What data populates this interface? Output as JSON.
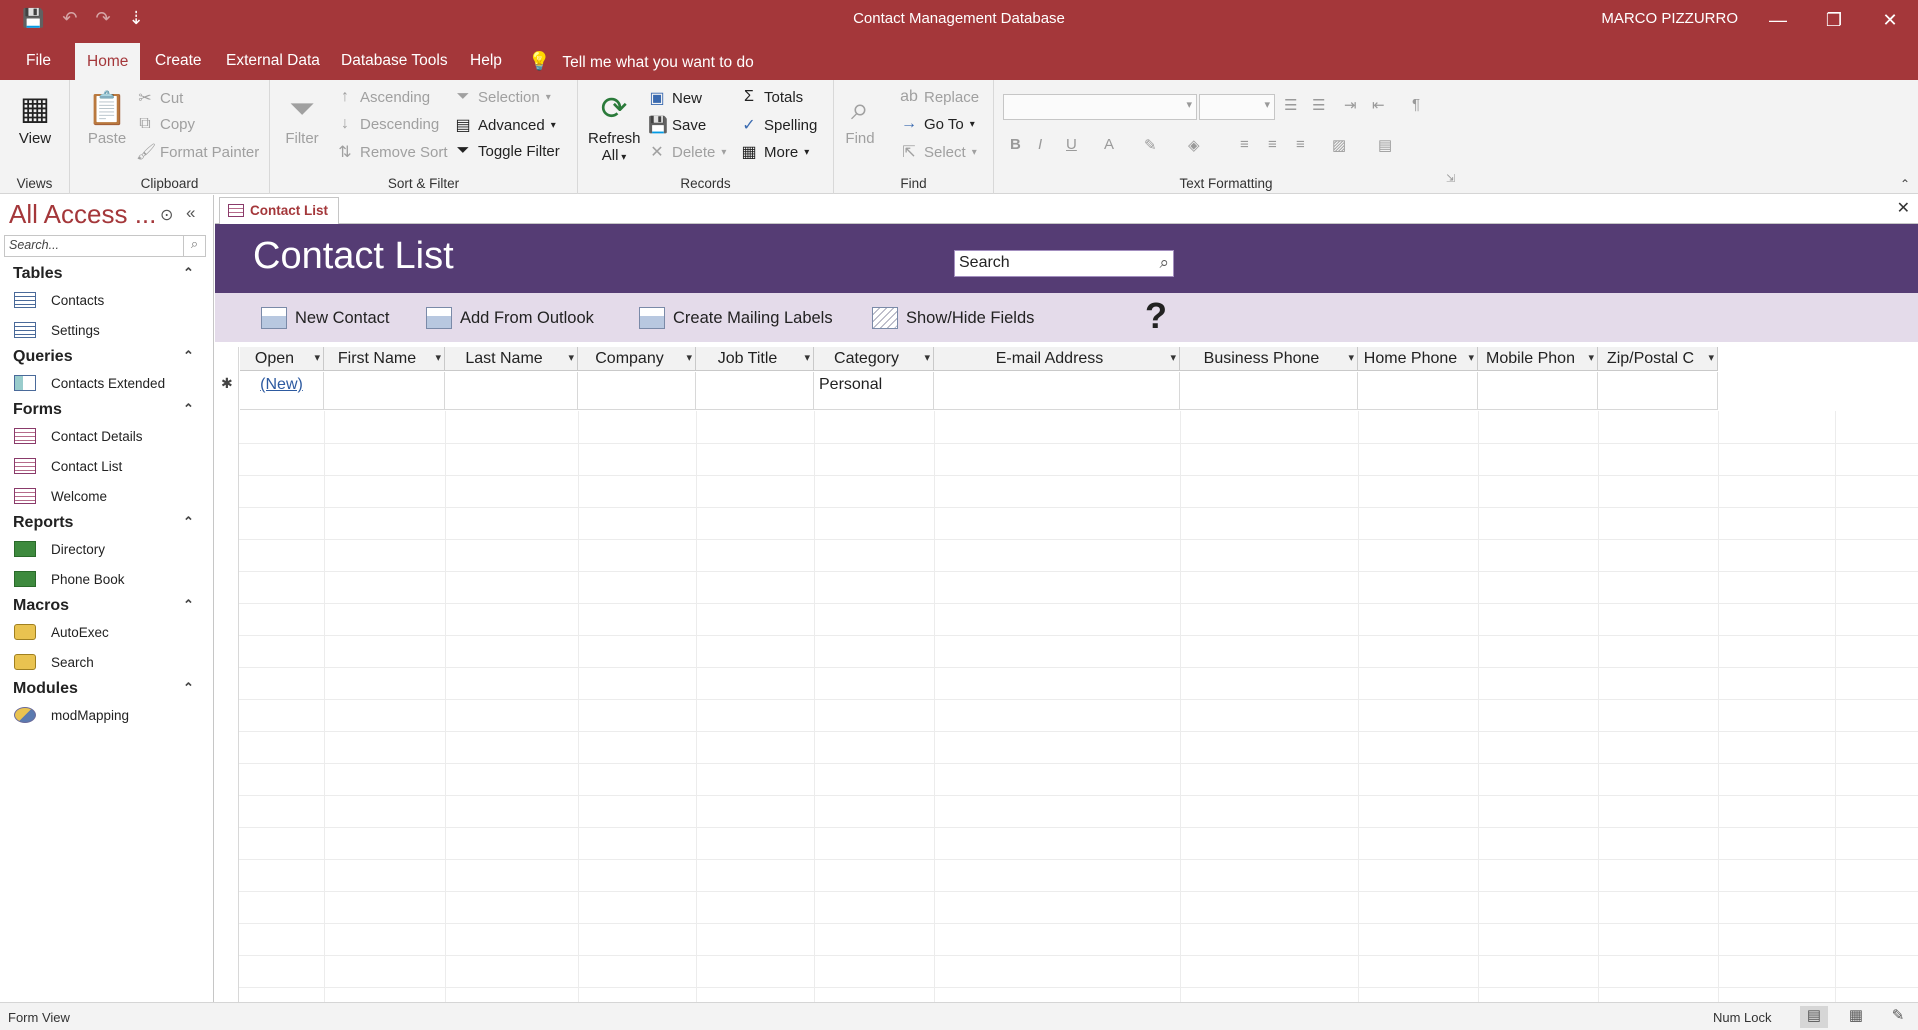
{
  "window": {
    "title": "Contact Management Database",
    "user": "MARCO PIZZURRO",
    "minimize": "—",
    "restore": "❐",
    "close": "✕"
  },
  "qat": {
    "save": "💾",
    "undo": "↶",
    "redo": "↷",
    "customize": "⇣"
  },
  "tabs": {
    "file": "File",
    "home": "Home",
    "create": "Create",
    "external_data": "External Data",
    "database_tools": "Database Tools",
    "help": "Help",
    "tell_me": "Tell me what you want to do"
  },
  "ribbon": {
    "views": {
      "label": "Views",
      "view": "View"
    },
    "clipboard": {
      "label": "Clipboard",
      "paste": "Paste",
      "cut": "Cut",
      "copy": "Copy",
      "format_painter": "Format Painter"
    },
    "sort_filter": {
      "label": "Sort & Filter",
      "filter": "Filter",
      "ascending": "Ascending",
      "descending": "Descending",
      "remove_sort": "Remove Sort",
      "selection": "Selection",
      "advanced": "Advanced",
      "toggle_filter": "Toggle Filter"
    },
    "records": {
      "label": "Records",
      "refresh": "Refresh",
      "all": "All",
      "new": "New",
      "save": "Save",
      "delete": "Delete",
      "totals": "Totals",
      "spelling": "Spelling",
      "more": "More"
    },
    "find": {
      "label": "Find",
      "find": "Find",
      "replace": "Replace",
      "go_to": "Go To",
      "select": "Select"
    },
    "text_formatting": {
      "label": "Text Formatting",
      "bold": "B",
      "italic": "I",
      "underline": "U",
      "font_color": "A"
    }
  },
  "nav": {
    "title": "All Access ...",
    "search_placeholder": "Search...",
    "categories": {
      "tables": "Tables",
      "queries": "Queries",
      "forms": "Forms",
      "reports": "Reports",
      "macros": "Macros",
      "modules": "Modules"
    },
    "items": {
      "contacts": "Contacts",
      "settings": "Settings",
      "contacts_extended": "Contacts Extended",
      "contact_details": "Contact Details",
      "contact_list": "Contact List",
      "welcome": "Welcome",
      "directory": "Directory",
      "phone_book": "Phone Book",
      "autoexec": "AutoExec",
      "search": "Search",
      "modmapping": "modMapping"
    }
  },
  "document": {
    "tab_label": "Contact List",
    "form_title": "Contact List",
    "search_value": "Search",
    "buttons": {
      "new_contact": "New Contact",
      "add_from_outlook": "Add From Outlook",
      "create_mailing_labels": "Create Mailing Labels",
      "show_hide_fields": "Show/Hide Fields",
      "help": "?"
    }
  },
  "datasheet": {
    "columns": [
      "Open",
      "First Name",
      "Last Name",
      "Company",
      "Job Title",
      "Category",
      "E-mail Address",
      "Business Phone",
      "Home Phone",
      "Mobile Phon",
      "Zip/Postal C"
    ],
    "new_row": {
      "open": "(New)",
      "category": "Personal"
    },
    "new_row_marker": "✱"
  },
  "status": {
    "mode": "Form View",
    "num_lock": "Num Lock"
  },
  "colors": {
    "accent": "#a4373a",
    "form_header": "#553c74",
    "form_bar": "#e4dbea"
  }
}
